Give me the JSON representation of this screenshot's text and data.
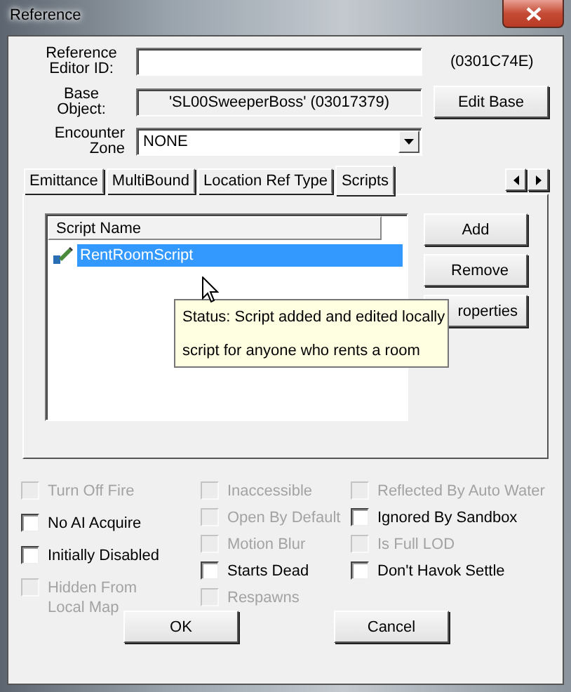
{
  "window": {
    "title": "Reference"
  },
  "editor_id": {
    "label": "Reference Editor ID:"
  },
  "form_id": "(0301C74E)",
  "base_object": {
    "label": "Base Object:",
    "value": "'SL00SweeperBoss' (03017379)"
  },
  "edit_base_button": "Edit Base",
  "encounter_zone": {
    "label": "Encounter Zone",
    "value": "NONE"
  },
  "tabs": [
    {
      "label": "Emittance",
      "selected": false
    },
    {
      "label": "MultiBound",
      "selected": false
    },
    {
      "label": "Location Ref Type",
      "selected": false
    },
    {
      "label": "Scripts",
      "selected": true
    }
  ],
  "script_list": {
    "columns": [
      "Script Name"
    ],
    "rows": [
      {
        "name": "RentRoomScript",
        "selected": true
      }
    ]
  },
  "script_buttons": [
    "Add",
    "Remove",
    "roperties"
  ],
  "tooltip": {
    "lines": [
      "Status: Script added and edited locally",
      "script for anyone who rents a room"
    ]
  },
  "flag_columns": [
    {
      "items": [
        {
          "label": "Turn Off Fire",
          "checked": false,
          "disabled": true
        },
        {
          "label": "No AI Acquire",
          "checked": false,
          "disabled": false
        },
        {
          "label": "Initially Disabled",
          "checked": false,
          "disabled": false
        },
        {
          "label": "Hidden From Local Map",
          "checked": false,
          "disabled": true
        }
      ]
    },
    {
      "items": [
        {
          "label": "Inaccessible",
          "checked": false,
          "disabled": true
        },
        {
          "label": "Open By Default",
          "checked": false,
          "disabled": true
        },
        {
          "label": "Motion Blur",
          "checked": false,
          "disabled": true
        },
        {
          "label": "Starts Dead",
          "checked": false,
          "disabled": false
        },
        {
          "label": "Respawns",
          "checked": false,
          "disabled": true
        }
      ]
    },
    {
      "items": [
        {
          "label": "Reflected By Auto Water",
          "checked": false,
          "disabled": true
        },
        {
          "label": "Ignored By Sandbox",
          "checked": false,
          "disabled": false
        },
        {
          "label": "Is Full LOD",
          "checked": false,
          "disabled": true
        },
        {
          "label": "Don't Havok Settle",
          "checked": false,
          "disabled": false
        }
      ]
    }
  ],
  "buttons": [
    "OK",
    "Cancel"
  ]
}
